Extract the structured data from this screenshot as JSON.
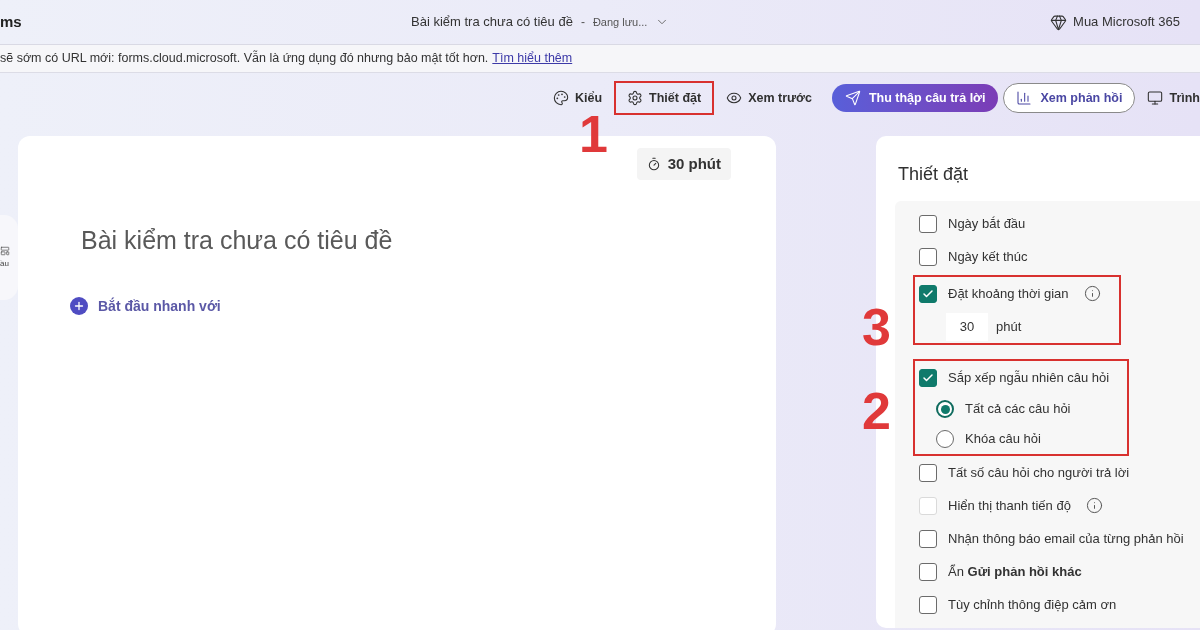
{
  "header": {
    "app_name": "ms",
    "document_title": "Bài kiểm tra chưa có tiêu đề",
    "separator": "-",
    "save_status": "Đang lưu...",
    "buy_label": "Mua Microsoft 365"
  },
  "banner": {
    "text": "sẽ sớm có URL mới: forms.cloud.microsoft. Vẫn là ứng dụng đó nhưng bảo mật tốt hơn.",
    "link": "Tìm hiểu thêm"
  },
  "toolbar": [
    {
      "kind": "plain",
      "label": "Kiểu"
    },
    {
      "kind": "plain",
      "label": "Thiết đặt",
      "annotation": "1"
    },
    {
      "kind": "plain",
      "label": "Xem trước"
    },
    {
      "kind": "primary",
      "label": "Thu thập câu trả lời"
    },
    {
      "kind": "outline",
      "label": "Xem phản hồi"
    },
    {
      "kind": "plain",
      "label": "Trình"
    }
  ],
  "left_rail": {
    "label": "ầu"
  },
  "form": {
    "timer": "30 phút",
    "title": "Bài kiểm tra chưa có tiêu đề",
    "quick_start": "Bắt đầu nhanh với"
  },
  "settings": {
    "title": "Thiết đặt",
    "items": [
      {
        "kind": "checkbox",
        "label": "Ngày bắt đầu",
        "checked": false,
        "disabled": false,
        "info": false
      },
      {
        "kind": "checkbox",
        "label": "Ngày kết thúc",
        "checked": false,
        "disabled": false,
        "info": false
      },
      {
        "kind": "group",
        "annotation": "3",
        "items": [
          {
            "kind": "checkbox",
            "label": "Đặt khoảng thời gian",
            "checked": true,
            "disabled": false,
            "info": true
          },
          {
            "kind": "duration",
            "value": "30",
            "unit": "phút"
          }
        ]
      },
      {
        "kind": "group",
        "annotation": "2",
        "items": [
          {
            "kind": "checkbox",
            "label": "Sắp xếp ngẫu nhiên câu hỏi",
            "checked": true,
            "disabled": false,
            "info": false
          },
          {
            "kind": "radio",
            "label": "Tất cả các câu hỏi",
            "selected": true
          },
          {
            "kind": "radio",
            "label": "Khóa câu hỏi",
            "selected": false
          }
        ]
      },
      {
        "kind": "checkbox",
        "label": "Tất số câu hỏi cho người trả lời",
        "checked": false,
        "disabled": false,
        "info": false
      },
      {
        "kind": "checkbox",
        "label": "Hiển thị thanh tiến độ",
        "checked": false,
        "disabled": true,
        "info": true
      },
      {
        "kind": "checkbox",
        "label": "Nhận thông báo email của từng phản hồi",
        "checked": false,
        "disabled": false,
        "info": false
      },
      {
        "kind": "checkbox",
        "label": "Ẩn **Gửi phản hồi khác**",
        "checked": false,
        "disabled": false,
        "info": false
      },
      {
        "kind": "checkbox",
        "label": "Tùy chỉnh thông điệp cảm ơn",
        "checked": false,
        "disabled": false,
        "info": false
      }
    ]
  }
}
